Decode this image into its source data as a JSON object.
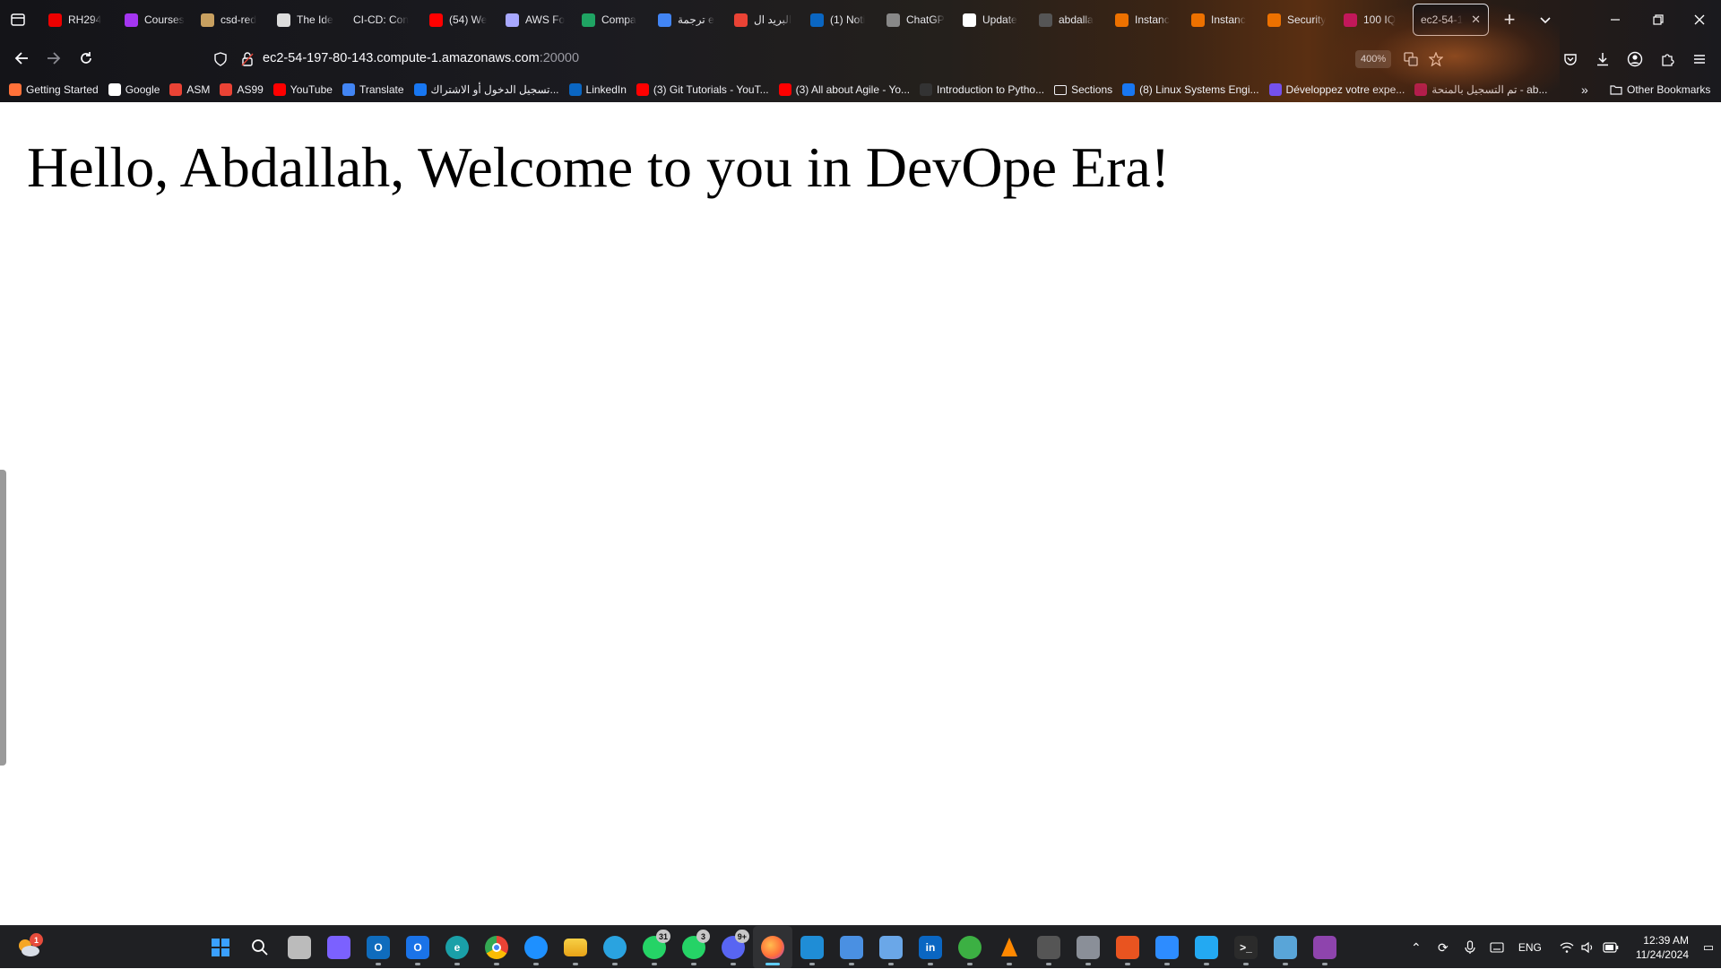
{
  "browser": {
    "tabs": [
      {
        "label": "RH294",
        "icon": "redhat-icon",
        "color": "#ee0000"
      },
      {
        "label": "Courses",
        "icon": "udemy-icon",
        "color": "#a435f0"
      },
      {
        "label": "csd-red",
        "icon": "person-icon",
        "color": "#c8a060"
      },
      {
        "label": "The Ide",
        "icon": "gear-icon",
        "color": "#dddddd"
      },
      {
        "label": "CI-CD: Con",
        "icon": "",
        "color": ""
      },
      {
        "label": "(54) We",
        "icon": "youtube-icon",
        "color": "#ff0000"
      },
      {
        "label": "AWS Fo",
        "icon": "cube-icon",
        "color": "#a8a8ff"
      },
      {
        "label": "Compa",
        "icon": "drive-icon",
        "color": "#1fa463"
      },
      {
        "label": "ترجمة e",
        "icon": "translate-icon",
        "color": "#4285f4"
      },
      {
        "label": "البريد ال",
        "icon": "gmail-icon",
        "color": "#ea4335"
      },
      {
        "label": "(1) Noti",
        "icon": "linkedin-icon",
        "color": "#0a66c2"
      },
      {
        "label": "ChatGP",
        "icon": "chatgpt-icon",
        "color": "#888888"
      },
      {
        "label": "Update",
        "icon": "github-icon",
        "color": "#ffffff"
      },
      {
        "label": "abdalla",
        "icon": "avatar-icon",
        "color": "#555555"
      },
      {
        "label": "Instanc",
        "icon": "aws-ec2-icon",
        "color": "#ed7100"
      },
      {
        "label": "Instanc",
        "icon": "aws-ec2-icon",
        "color": "#ed7100"
      },
      {
        "label": "Security",
        "icon": "aws-ec2-icon",
        "color": "#ed7100"
      },
      {
        "label": "100 IQ",
        "icon": "pin-icon",
        "color": "#c2185b"
      },
      {
        "label": "ec2-54-1",
        "icon": "",
        "color": "",
        "active": true,
        "close": "✕"
      }
    ],
    "new_tab": "+",
    "url_host": "ec2-54-197-80-143.compute-1.amazonaws.com",
    "url_port": ":20000",
    "zoom": "400%",
    "bookmarks": [
      {
        "label": "Getting Started",
        "icon": "firefox-icon",
        "color": "#ff7139"
      },
      {
        "label": "Google",
        "icon": "google-icon",
        "color": "#ffffff"
      },
      {
        "label": "ASM",
        "icon": "gmail-icon",
        "color": "#ea4335"
      },
      {
        "label": "AS99",
        "icon": "gmail-icon",
        "color": "#ea4335"
      },
      {
        "label": "YouTube",
        "icon": "youtube-icon",
        "color": "#ff0000"
      },
      {
        "label": "Translate",
        "icon": "translate-icon",
        "color": "#4285f4"
      },
      {
        "label": "تسجيل الدخول أو الاشتراك...",
        "icon": "facebook-icon",
        "color": "#1877f2"
      },
      {
        "label": "LinkedIn",
        "icon": "linkedin-icon",
        "color": "#0a66c2"
      },
      {
        "label": "(3) Git Tutorials - YouT...",
        "icon": "youtube-icon",
        "color": "#ff0000"
      },
      {
        "label": "(3) All about Agile - Yo...",
        "icon": "youtube-icon",
        "color": "#ff0000"
      },
      {
        "label": "Introduction to Pytho...",
        "icon": "check-icon",
        "color": "#333333"
      },
      {
        "label": "Sections",
        "icon": "folder-icon",
        "color": ""
      },
      {
        "label": "(8) Linux Systems Engi...",
        "icon": "facebook-icon",
        "color": "#1877f2"
      },
      {
        "label": "Développez votre expe...",
        "icon": "openclassrooms-icon",
        "color": "#7451eb"
      },
      {
        "label": "تم التسجيل بالمنحة - ab...",
        "icon": "pin-icon",
        "color": "#c2185b"
      }
    ],
    "other_bookmarks": "Other Bookmarks"
  },
  "page": {
    "heading": "Hello, Abdallah, Welcome to you in DevOpe Era!"
  },
  "taskbar": {
    "apps": [
      {
        "name": "start",
        "glyph": "",
        "color": "#3aa0ff"
      },
      {
        "name": "search",
        "glyph": "",
        "color": ""
      },
      {
        "name": "task-view",
        "glyph": "",
        "color": "#bbbbbb"
      },
      {
        "name": "copilot",
        "glyph": "",
        "color": "#7b61ff"
      },
      {
        "name": "outlook",
        "glyph": "O",
        "color": "#0f6cbd"
      },
      {
        "name": "outlook-new",
        "glyph": "O",
        "color": "#1a73e8"
      },
      {
        "name": "edge",
        "glyph": "e",
        "color": "#1aa0a8"
      },
      {
        "name": "chrome",
        "glyph": "",
        "color": "#fbbc04"
      },
      {
        "name": "safari",
        "glyph": "",
        "color": "#1e90ff"
      },
      {
        "name": "file-explorer",
        "glyph": "",
        "color": "#f4c430"
      },
      {
        "name": "telegram",
        "glyph": "",
        "color": "#2aa3e0"
      },
      {
        "name": "whatsapp",
        "glyph": "",
        "color": "#25d366",
        "badge": "31"
      },
      {
        "name": "whatsapp-business",
        "glyph": "",
        "color": "#25d366",
        "badge": "3"
      },
      {
        "name": "discord",
        "glyph": "",
        "color": "#5865f2",
        "badge": "9+"
      },
      {
        "name": "firefox",
        "glyph": "",
        "color": "#ff7139",
        "active": true
      },
      {
        "name": "virtualbox",
        "glyph": "",
        "color": "#1f8dd6"
      },
      {
        "name": "photos",
        "glyph": "",
        "color": "#4a90e2"
      },
      {
        "name": "image-viewer",
        "glyph": "",
        "color": "#6aa7e8"
      },
      {
        "name": "linkedin",
        "glyph": "in",
        "color": "#0a66c2"
      },
      {
        "name": "vpn",
        "glyph": "",
        "color": "#3cb043"
      },
      {
        "name": "vlc",
        "glyph": "",
        "color": "#ff8800"
      },
      {
        "name": "clapper",
        "glyph": "",
        "color": "#555555"
      },
      {
        "name": "calculator",
        "glyph": "",
        "color": "#8a8f98"
      },
      {
        "name": "ubuntu",
        "glyph": "",
        "color": "#e95420"
      },
      {
        "name": "zoom",
        "glyph": "",
        "color": "#2d8cff"
      },
      {
        "name": "vscode",
        "glyph": "",
        "color": "#23a9f2"
      },
      {
        "name": "terminal",
        "glyph": ">_",
        "color": "#2b2b2b"
      },
      {
        "name": "notepad",
        "glyph": "",
        "color": "#59a5d8"
      },
      {
        "name": "app-purple",
        "glyph": "",
        "color": "#8e44ad"
      }
    ],
    "language": "ENG",
    "time": "12:39 AM",
    "date": "11/24/2024",
    "widget_badge": "1"
  }
}
